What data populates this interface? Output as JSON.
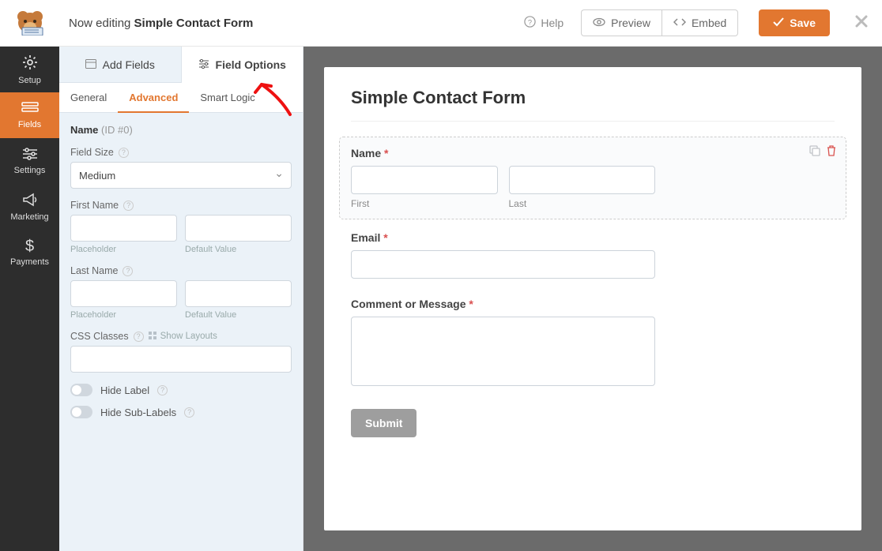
{
  "header": {
    "editing_prefix": "Now editing ",
    "form_name": "Simple Contact Form",
    "help": "Help",
    "preview": "Preview",
    "embed": "Embed",
    "save": "Save"
  },
  "sidebar": {
    "items": [
      {
        "label": "Setup"
      },
      {
        "label": "Fields"
      },
      {
        "label": "Settings"
      },
      {
        "label": "Marketing"
      },
      {
        "label": "Payments"
      }
    ]
  },
  "panel": {
    "tabs_primary": {
      "add": "Add Fields",
      "options": "Field Options"
    },
    "tabs_secondary": {
      "general": "General",
      "advanced": "Advanced",
      "smart": "Smart Logic"
    },
    "field_name": "Name",
    "field_id": "(ID #0)",
    "size_label": "Field Size",
    "size_value": "Medium",
    "first_name_label": "First Name",
    "last_name_label": "Last Name",
    "hint_placeholder": "Placeholder",
    "hint_default": "Default Value",
    "css_label": "CSS Classes",
    "show_layouts": "Show Layouts",
    "hide_label": "Hide Label",
    "hide_sublabels": "Hide Sub-Labels"
  },
  "preview": {
    "title": "Simple Contact Form",
    "name_label": "Name",
    "first_sub": "First",
    "last_sub": "Last",
    "email_label": "Email",
    "comment_label": "Comment or Message",
    "submit": "Submit"
  }
}
